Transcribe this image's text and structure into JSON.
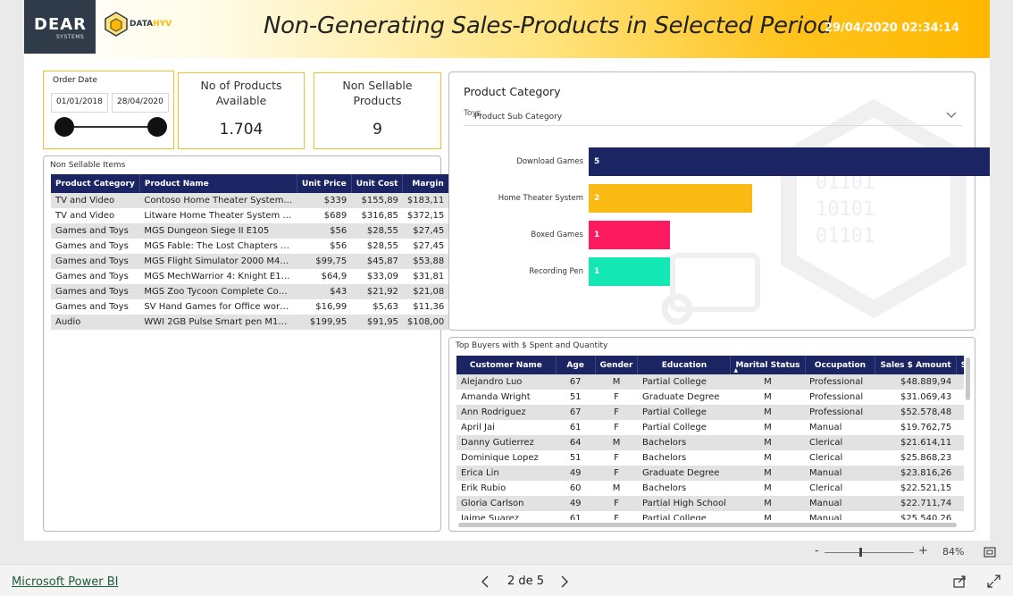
{
  "header": {
    "logo_text": "DEAR",
    "logo_sub": "SYSTEMS",
    "partner_logo_prefix": "DATA",
    "partner_logo_suffix": "HYV",
    "title": "Non-Generating Sales-Products in Selected Period",
    "datetime": "29/04/2020 02:34:14",
    "accent_color": "#ffb800"
  },
  "slicer": {
    "label": "Order Date",
    "start": "01/01/2018",
    "end": "28/04/2020"
  },
  "kpis": [
    {
      "caption": "No of Products Available",
      "value": "1.704"
    },
    {
      "caption": "Non Sellable Products",
      "value": "9"
    }
  ],
  "non_sellable": {
    "title": "Non Sellable Items",
    "columns": [
      "Product Category",
      "Product Name",
      "Unit Price",
      "Unit Cost",
      "Margin"
    ],
    "rows": [
      [
        "TV and Video",
        "Contoso Home Theater System…",
        "$339",
        "$155,89",
        "$183,11"
      ],
      [
        "TV and Video",
        "Litware Home Theater System …",
        "$689",
        "$316,85",
        "$372,15"
      ],
      [
        "Games and Toys",
        "MGS Dungeon Siege II E105",
        "$56",
        "$28,55",
        "$27,45"
      ],
      [
        "Games and Toys",
        "MGS Fable: The Lost Chapters …",
        "$56",
        "$28,55",
        "$27,45"
      ],
      [
        "Games and Toys",
        "MGS Flight Simulator 2000 M4…",
        "$99,75",
        "$45,87",
        "$53,88"
      ],
      [
        "Games and Toys",
        "MGS MechWarrior 4: Knight E1…",
        "$64,9",
        "$33,09",
        "$31,81"
      ],
      [
        "Games and Toys",
        "MGS Zoo Tycoon Complete Co…",
        "$43",
        "$21,92",
        "$21,08"
      ],
      [
        "Games and Toys",
        "SV Hand Games for Office wor…",
        "$16,99",
        "$5,63",
        "$11,36"
      ],
      [
        "Audio",
        "WWI 2GB Pulse Smart pen M1…",
        "$199,95",
        "$91,95",
        "$108,00"
      ]
    ]
  },
  "category_panel": {
    "title": "Product Category",
    "dropdown_value": "Toys",
    "dropdown_overlay": "Product Sub Category"
  },
  "chart_data": {
    "type": "bar",
    "orientation": "horizontal",
    "categories": [
      "Download Games",
      "Home Theater System",
      "Boxed Games",
      "Recording Pen"
    ],
    "values": [
      5,
      2,
      1,
      1
    ],
    "colors": [
      "#1c2564",
      "#fbb913",
      "#fe1a5f",
      "#13e8b4"
    ],
    "xlim": [
      0,
      5
    ]
  },
  "buyers": {
    "title": "Top Buyers with $ Spent and Quantity",
    "columns": [
      "Customer Name",
      "Age",
      "Gender",
      "Education",
      "Marital Status",
      "Occupation",
      "Sales $ Amount",
      "Sa"
    ],
    "rows": [
      [
        "Alejandro Luo",
        "67",
        "M",
        "Partial College",
        "M",
        "Professional",
        "$48.889,94"
      ],
      [
        "Amanda Wright",
        "51",
        "F",
        "Graduate Degree",
        "M",
        "Professional",
        "$31.069,43"
      ],
      [
        "Ann Rodriguez",
        "67",
        "F",
        "Partial College",
        "M",
        "Professional",
        "$52.578,48"
      ],
      [
        "April Jai",
        "61",
        "F",
        "Partial College",
        "M",
        "Manual",
        "$19.762,75"
      ],
      [
        "Danny Gutierrez",
        "64",
        "M",
        "Bachelors",
        "M",
        "Clerical",
        "$21.614,11"
      ],
      [
        "Dominique Lopez",
        "51",
        "F",
        "Bachelors",
        "M",
        "Clerical",
        "$25.868,23"
      ],
      [
        "Erica Lin",
        "49",
        "F",
        "Graduate Degree",
        "M",
        "Manual",
        "$23.816,26"
      ],
      [
        "Erik Rubio",
        "60",
        "M",
        "Bachelors",
        "M",
        "Clerical",
        "$22.521,15"
      ],
      [
        "Gloria Carlson",
        "49",
        "F",
        "Partial High School",
        "M",
        "Manual",
        "$22.711,74"
      ],
      [
        "Jaime Suarez",
        "61",
        "F",
        "Partial College",
        "M",
        "Manual",
        "$25.540,26"
      ]
    ]
  },
  "zoom": {
    "minus": "-",
    "plus": "+",
    "level": "84%"
  },
  "footer": {
    "brand_link": "Microsoft Power BI",
    "page_indicator": "2 de 5"
  }
}
